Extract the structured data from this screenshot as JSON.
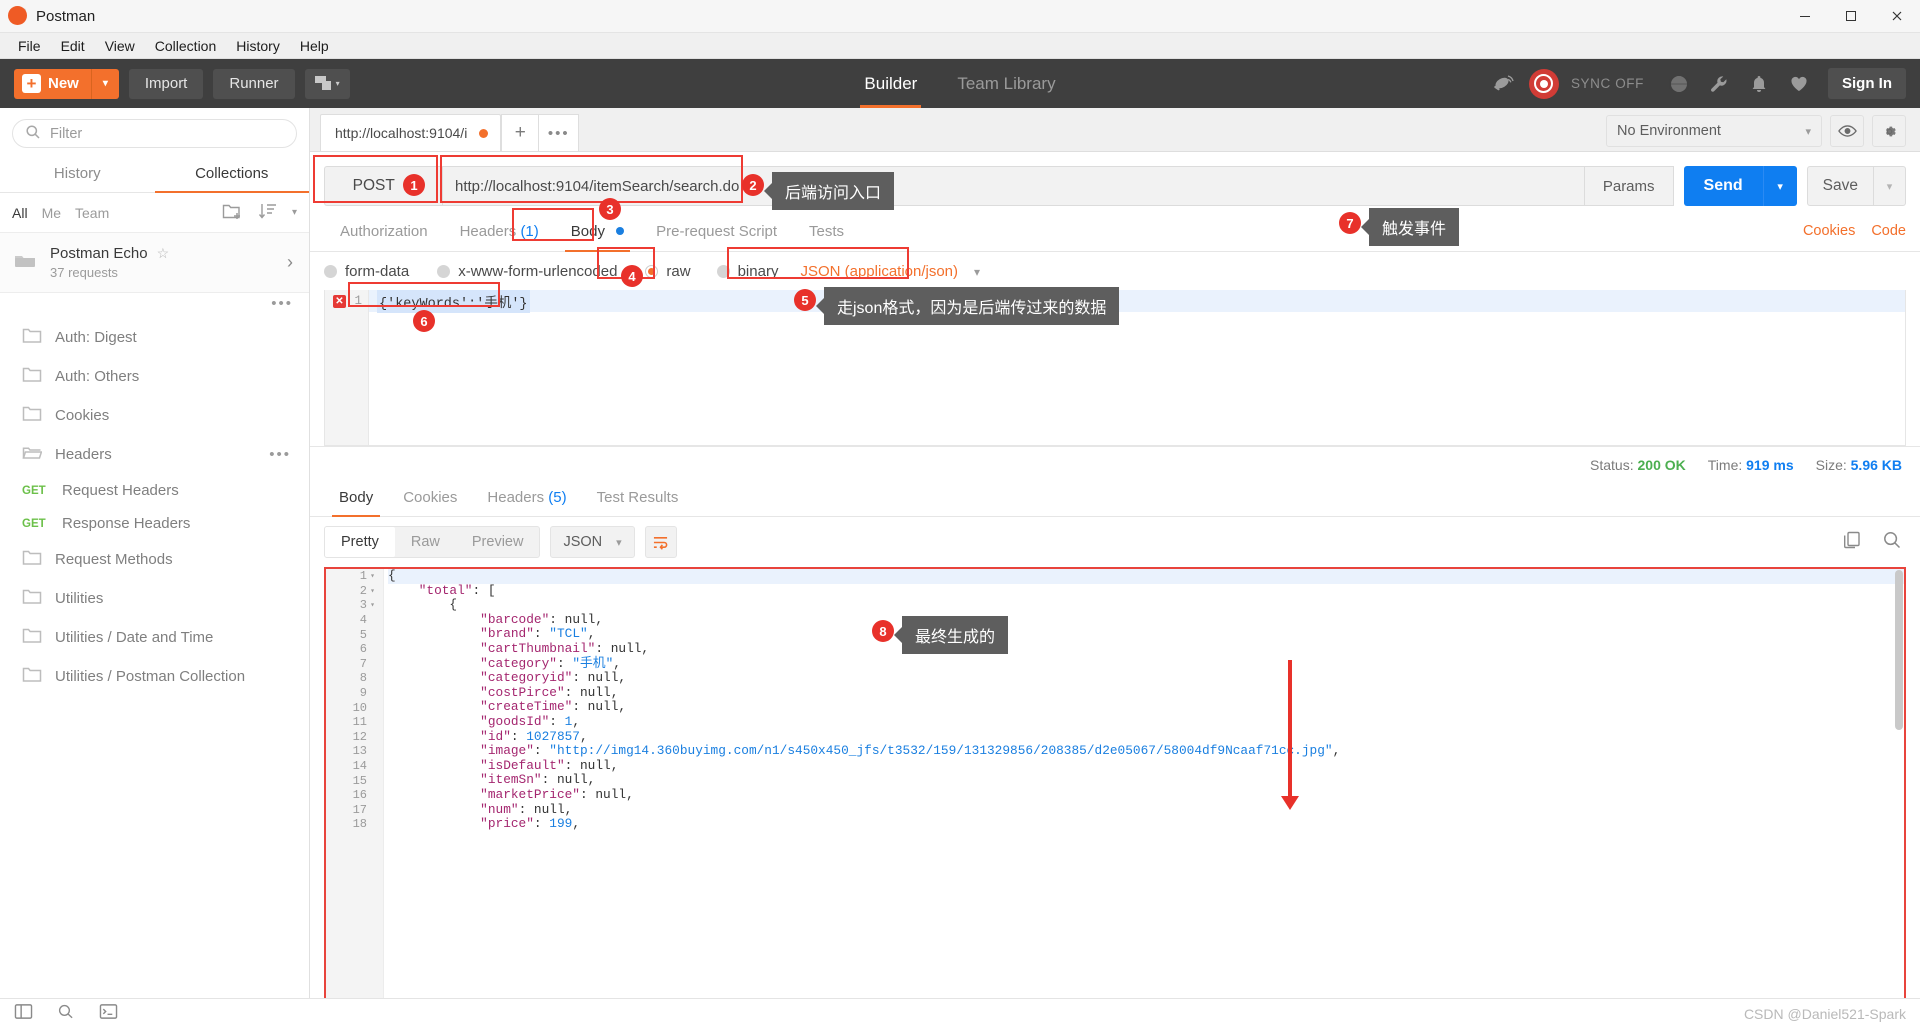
{
  "window": {
    "title": "Postman",
    "minimize": "–",
    "maximize": "▢",
    "close": "✕"
  },
  "menubar": {
    "items": [
      "File",
      "Edit",
      "View",
      "Collection",
      "History",
      "Help"
    ]
  },
  "appheader": {
    "new_label": "New",
    "new_plus": "+",
    "import_label": "Import",
    "runner_label": "Runner",
    "tabs": [
      {
        "label": "Builder",
        "active": true
      },
      {
        "label": "Team Library",
        "active": false
      }
    ],
    "sync_text": "SYNC OFF",
    "signin_label": "Sign In"
  },
  "sidebar": {
    "filter_placeholder": "Filter",
    "tabs": [
      {
        "label": "History",
        "active": false
      },
      {
        "label": "Collections",
        "active": true
      }
    ],
    "scopes": [
      {
        "label": "All",
        "active": true
      },
      {
        "label": "Me",
        "active": false
      },
      {
        "label": "Team",
        "active": false
      }
    ],
    "collection": {
      "name": "Postman Echo",
      "requests": "37 requests",
      "star": "☆",
      "chevron": "›",
      "more": "•••"
    },
    "items": [
      {
        "type": "folder",
        "label": "Auth: Digest"
      },
      {
        "type": "folder",
        "label": "Auth: Others"
      },
      {
        "type": "folder",
        "label": "Cookies"
      },
      {
        "type": "folder-open",
        "label": "Headers",
        "more": "•••"
      },
      {
        "type": "request",
        "verb": "GET",
        "label": "Request Headers"
      },
      {
        "type": "request",
        "verb": "GET",
        "label": "Response Headers"
      },
      {
        "type": "folder",
        "label": "Request Methods"
      },
      {
        "type": "folder",
        "label": "Utilities"
      },
      {
        "type": "folder",
        "label": "Utilities / Date and Time"
      },
      {
        "type": "folder",
        "label": "Utilities / Postman Collection"
      }
    ]
  },
  "tabstrip": {
    "request_tab_label": "http://localhost:9104/i",
    "new_tab": "+",
    "more_tabs": "•••",
    "environment": "No Environment",
    "env_caret": "⌄"
  },
  "request": {
    "method": "POST",
    "method_caret": "⌄",
    "url": "http://localhost:9104/itemSearch/search.do",
    "params_label": "Params",
    "send_label": "Send",
    "send_caret": "⌄",
    "save_label": "Save",
    "save_caret": "⌄",
    "tabs": [
      {
        "label": "Authorization",
        "active": false
      },
      {
        "label": "Headers",
        "count": "(1)",
        "active": false
      },
      {
        "label": "Body",
        "active": true,
        "dot": true
      },
      {
        "label": "Pre-request Script",
        "active": false
      },
      {
        "label": "Tests",
        "active": false
      }
    ],
    "right_links": [
      "Cookies",
      "Code"
    ],
    "body_types": [
      {
        "label": "form-data",
        "selected": false
      },
      {
        "label": "x-www-form-urlencoded",
        "selected": false
      },
      {
        "label": "raw",
        "selected": true
      },
      {
        "label": "binary",
        "selected": false
      }
    ],
    "content_type": "JSON (application/json)",
    "content_type_caret": "⌄",
    "editor": {
      "line_number": "1",
      "error_mark": "✕",
      "code": "{'keyWords':'手机'}"
    }
  },
  "response": {
    "status_label": "Status:",
    "status_value": "200 OK",
    "time_label": "Time:",
    "time_value": "919 ms",
    "size_label": "Size:",
    "size_value": "5.96 KB",
    "tabs": [
      {
        "label": "Body",
        "active": true
      },
      {
        "label": "Cookies",
        "active": false
      },
      {
        "label": "Headers",
        "count": "(5)",
        "active": false
      },
      {
        "label": "Test Results",
        "active": false
      }
    ],
    "view_modes": [
      {
        "label": "Pretty",
        "active": true
      },
      {
        "label": "Raw",
        "active": false
      },
      {
        "label": "Preview",
        "active": false
      }
    ],
    "format": "JSON",
    "format_caret": "⌄",
    "lines": [
      {
        "n": "1",
        "fold": "▾",
        "html": "{"
      },
      {
        "n": "2",
        "fold": "▾",
        "html": "    <span class=\"k\">\"total\"</span>: ["
      },
      {
        "n": "3",
        "fold": "▾",
        "html": "        {"
      },
      {
        "n": "4",
        "fold": "",
        "html": "            <span class=\"k\">\"barcode\"</span>: null,"
      },
      {
        "n": "5",
        "fold": "",
        "html": "            <span class=\"k\">\"brand\"</span>: <span class=\"s\">\"TCL\"</span>,"
      },
      {
        "n": "6",
        "fold": "",
        "html": "            <span class=\"k\">\"cartThumbnail\"</span>: null,"
      },
      {
        "n": "7",
        "fold": "",
        "html": "            <span class=\"k\">\"category\"</span>: <span class=\"s\">\"手机\"</span>,"
      },
      {
        "n": "8",
        "fold": "",
        "html": "            <span class=\"k\">\"categoryid\"</span>: null,"
      },
      {
        "n": "9",
        "fold": "",
        "html": "            <span class=\"k\">\"costPirce\"</span>: null,"
      },
      {
        "n": "10",
        "fold": "",
        "html": "            <span class=\"k\">\"createTime\"</span>: null,"
      },
      {
        "n": "11",
        "fold": "",
        "html": "            <span class=\"k\">\"goodsId\"</span>: <span class=\"n\">1</span>,"
      },
      {
        "n": "12",
        "fold": "",
        "html": "            <span class=\"k\">\"id\"</span>: <span class=\"n\">1027857</span>,"
      },
      {
        "n": "13",
        "fold": "",
        "html": "            <span class=\"k\">\"image\"</span>: <span class=\"s\">\"http://img14.360buyimg.com/n1/s450x450_jfs/t3532/159/131329856/208385/d2e05067/58004df9Ncaaf71cc.jpg\"</span>,"
      },
      {
        "n": "14",
        "fold": "",
        "html": "            <span class=\"k\">\"isDefault\"</span>: null,"
      },
      {
        "n": "15",
        "fold": "",
        "html": "            <span class=\"k\">\"itemSn\"</span>: null,"
      },
      {
        "n": "16",
        "fold": "",
        "html": "            <span class=\"k\">\"marketPrice\"</span>: null,"
      },
      {
        "n": "17",
        "fold": "",
        "html": "            <span class=\"k\">\"num\"</span>: null,"
      },
      {
        "n": "18",
        "fold": "",
        "html": "            <span class=\"k\">\"price\"</span>: <span class=\"n\">199</span>,"
      }
    ]
  },
  "annotations": {
    "badges": [
      "1",
      "2",
      "3",
      "4",
      "5",
      "6",
      "7",
      "8"
    ],
    "callouts": [
      {
        "id": "2",
        "text": "后端访问入口"
      },
      {
        "id": "7",
        "text": "触发事件"
      },
      {
        "id": "5",
        "text": "走json格式，因为是后端传过来的数据"
      },
      {
        "id": "8",
        "text": "最终生成的"
      }
    ]
  },
  "footer": {
    "watermark": "CSDN @Daniel521-Spark"
  }
}
